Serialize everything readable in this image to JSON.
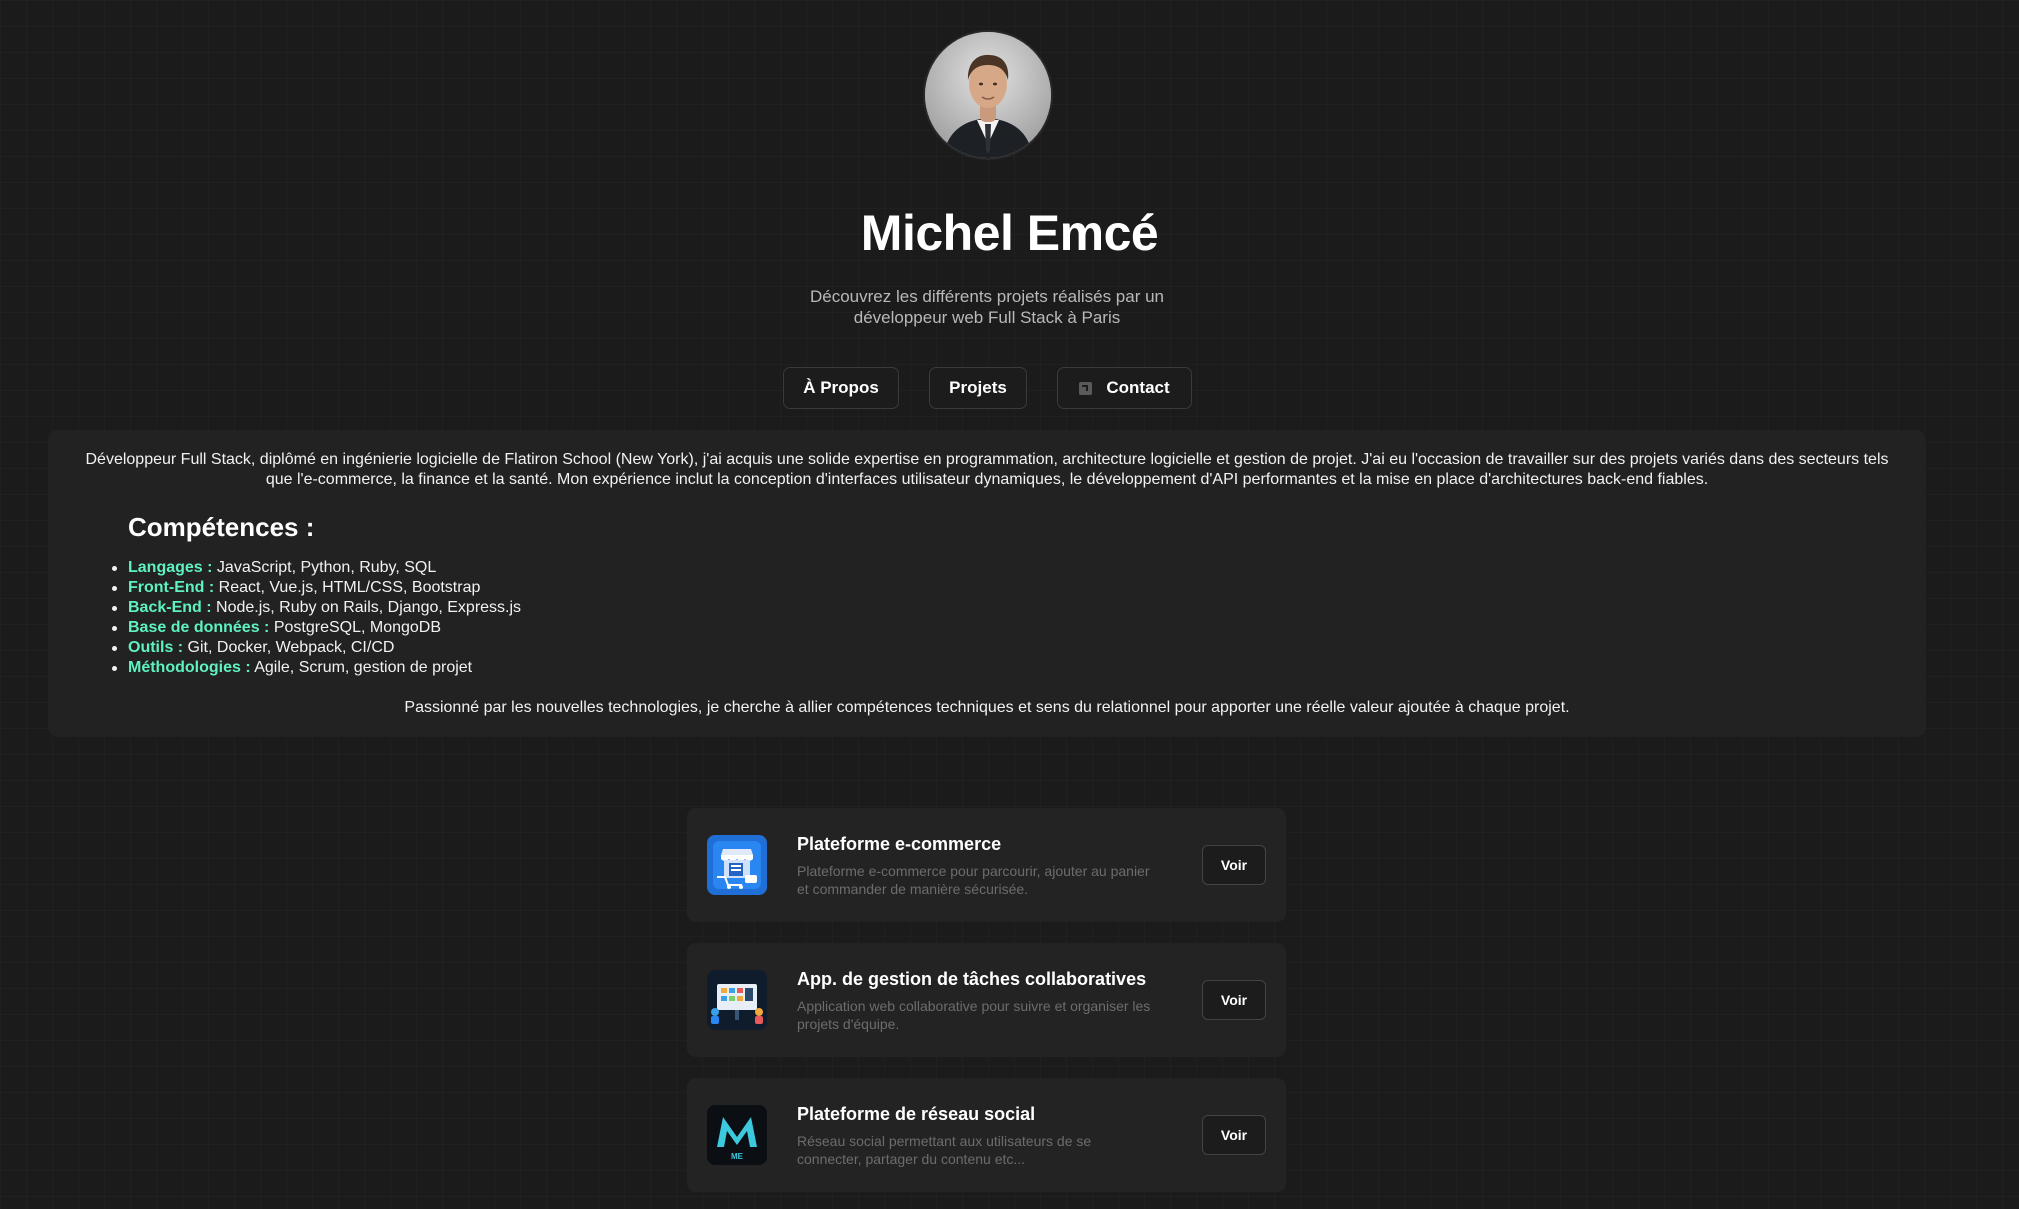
{
  "profile": {
    "name": "Michel Emcé",
    "subtitle": "Découvrez les différents projets réalisés par un développeur web Full Stack à Paris",
    "avatar_icon": "person-portrait-icon"
  },
  "nav": {
    "about_label": "À Propos",
    "projects_label": "Projets",
    "contact_label": "Contact",
    "contact_icon": "external-link-icon"
  },
  "about": {
    "intro": "Développeur Full Stack, diplômé en ingénierie logicielle de Flatiron School (New York), j'ai acquis une solide expertise en programmation, architecture logicielle et gestion de projet. J'ai eu l'occasion de travailler sur des projets variés dans des secteurs tels que l'e-commerce, la finance et la santé. Mon expérience inclut la conception d'interfaces utilisateur dynamiques, le développement d'API performantes et la mise en place d'architectures back-end fiables.",
    "skills_title": "Compétences :",
    "skills": [
      {
        "key": "Langages :",
        "value": " JavaScript, Python, Ruby, SQL"
      },
      {
        "key": "Front-End :",
        "value": " React, Vue.js, HTML/CSS, Bootstrap"
      },
      {
        "key": "Back-End :",
        "value": " Node.js, Ruby on Rails, Django, Express.js"
      },
      {
        "key": "Base de données :",
        "value": " PostgreSQL, MongoDB"
      },
      {
        "key": "Outils :",
        "value": " Git, Docker, Webpack, CI/CD"
      },
      {
        "key": "Méthodologies :",
        "value": " Agile, Scrum, gestion de projet"
      }
    ],
    "outro": "Passionné par les nouvelles technologies, je cherche à allier compétences techniques et sens du relationnel pour apporter une réelle valeur ajoutée à chaque projet."
  },
  "projects": [
    {
      "title": "Plateforme e-commerce",
      "description": "Plateforme e-commerce pour parcourir, ajouter au panier et commander de manière sécurisée.",
      "button_label": "Voir",
      "icon": "shop-storefront-icon"
    },
    {
      "title": "App. de gestion de tâches collaboratives",
      "description": "Application web collaborative pour suivre et organiser les projets d'équipe.",
      "button_label": "Voir",
      "icon": "task-board-icon"
    },
    {
      "title": "Plateforme de réseau social",
      "description": "Réseau social permettant aux utilisateurs de se connecter, partager du contenu etc...",
      "button_label": "Voir",
      "icon": "me-logo-icon",
      "icon_text": "ME"
    }
  ],
  "colors": {
    "background": "#1b1b1b",
    "card": "#222222",
    "accent": "#5ef2c2",
    "muted_text": "#6c6c6c"
  }
}
